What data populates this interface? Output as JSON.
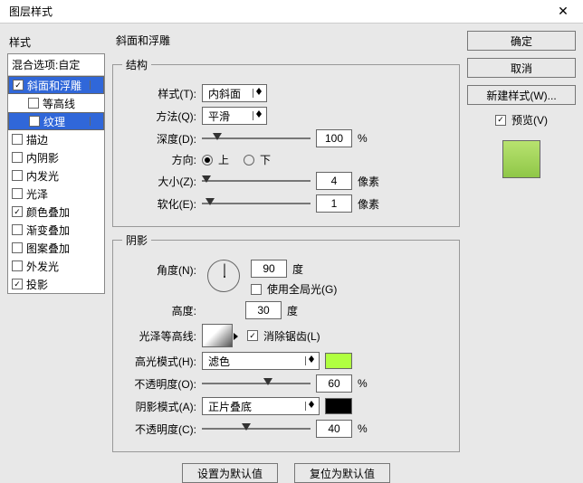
{
  "title": "图层样式",
  "sidebar": {
    "header": "样式",
    "blend": "混合选项:自定",
    "items": [
      {
        "label": "斜面和浮雕",
        "checked": true,
        "selected": true
      },
      {
        "label": "等高线",
        "checked": false,
        "sub": true
      },
      {
        "label": "纹理",
        "checked": false,
        "sub": true,
        "selected": true
      },
      {
        "label": "描边",
        "checked": false
      },
      {
        "label": "内阴影",
        "checked": false
      },
      {
        "label": "内发光",
        "checked": false
      },
      {
        "label": "光泽",
        "checked": false
      },
      {
        "label": "颜色叠加",
        "checked": true
      },
      {
        "label": "渐变叠加",
        "checked": false
      },
      {
        "label": "图案叠加",
        "checked": false
      },
      {
        "label": "外发光",
        "checked": false
      },
      {
        "label": "投影",
        "checked": true
      }
    ]
  },
  "panel": {
    "title": "斜面和浮雕",
    "structure": {
      "legend": "结构",
      "style_label": "样式(T):",
      "style_value": "内斜面",
      "method_label": "方法(Q):",
      "method_value": "平滑",
      "depth_label": "深度(D):",
      "depth_value": "100",
      "depth_unit": "%",
      "dir_label": "方向:",
      "up": "上",
      "down": "下",
      "size_label": "大小(Z):",
      "size_value": "4",
      "size_unit": "像素",
      "soften_label": "软化(E):",
      "soften_value": "1",
      "soften_unit": "像素"
    },
    "shadow": {
      "legend": "阴影",
      "angle_label": "角度(N):",
      "angle_value": "90",
      "angle_unit": "度",
      "global_label": "使用全局光(G)",
      "alt_label": "高度:",
      "alt_value": "30",
      "alt_unit": "度",
      "gloss_label": "光泽等高线:",
      "aa_label": "消除锯齿(L)",
      "hmode_label": "高光模式(H):",
      "hmode_value": "滤色",
      "hcolor": "#b0ff40",
      "hop_label": "不透明度(O):",
      "hop_value": "60",
      "hop_unit": "%",
      "smode_label": "阴影模式(A):",
      "smode_value": "正片叠底",
      "scolor": "#000000",
      "sop_label": "不透明度(C):",
      "sop_value": "40",
      "sop_unit": "%"
    },
    "set_default": "设置为默认值",
    "reset_default": "复位为默认值"
  },
  "right": {
    "ok": "确定",
    "cancel": "取消",
    "newstyle": "新建样式(W)...",
    "preview": "预览(V)"
  }
}
